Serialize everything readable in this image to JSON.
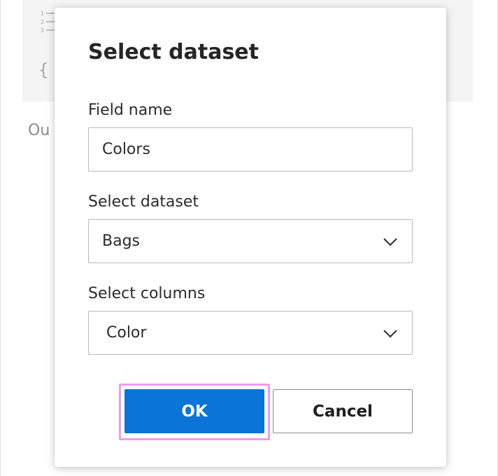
{
  "background": {
    "output_label": "Ou"
  },
  "dialog": {
    "title": "Select dataset",
    "field_name": {
      "label": "Field name",
      "value": "Colors"
    },
    "dataset_select": {
      "label": "Select dataset",
      "value": "Bags"
    },
    "columns_select": {
      "label": "Select columns",
      "value": "Color"
    },
    "buttons": {
      "ok": "OK",
      "cancel": "Cancel"
    }
  },
  "icons": {
    "list": "numbered-list-icon",
    "braces": "braces-icon",
    "chevron": "chevron-down-icon"
  },
  "colors": {
    "primary": "#0b74d7",
    "focus_ring": "#ee9bf0",
    "input_border": "#b9b9b9"
  }
}
